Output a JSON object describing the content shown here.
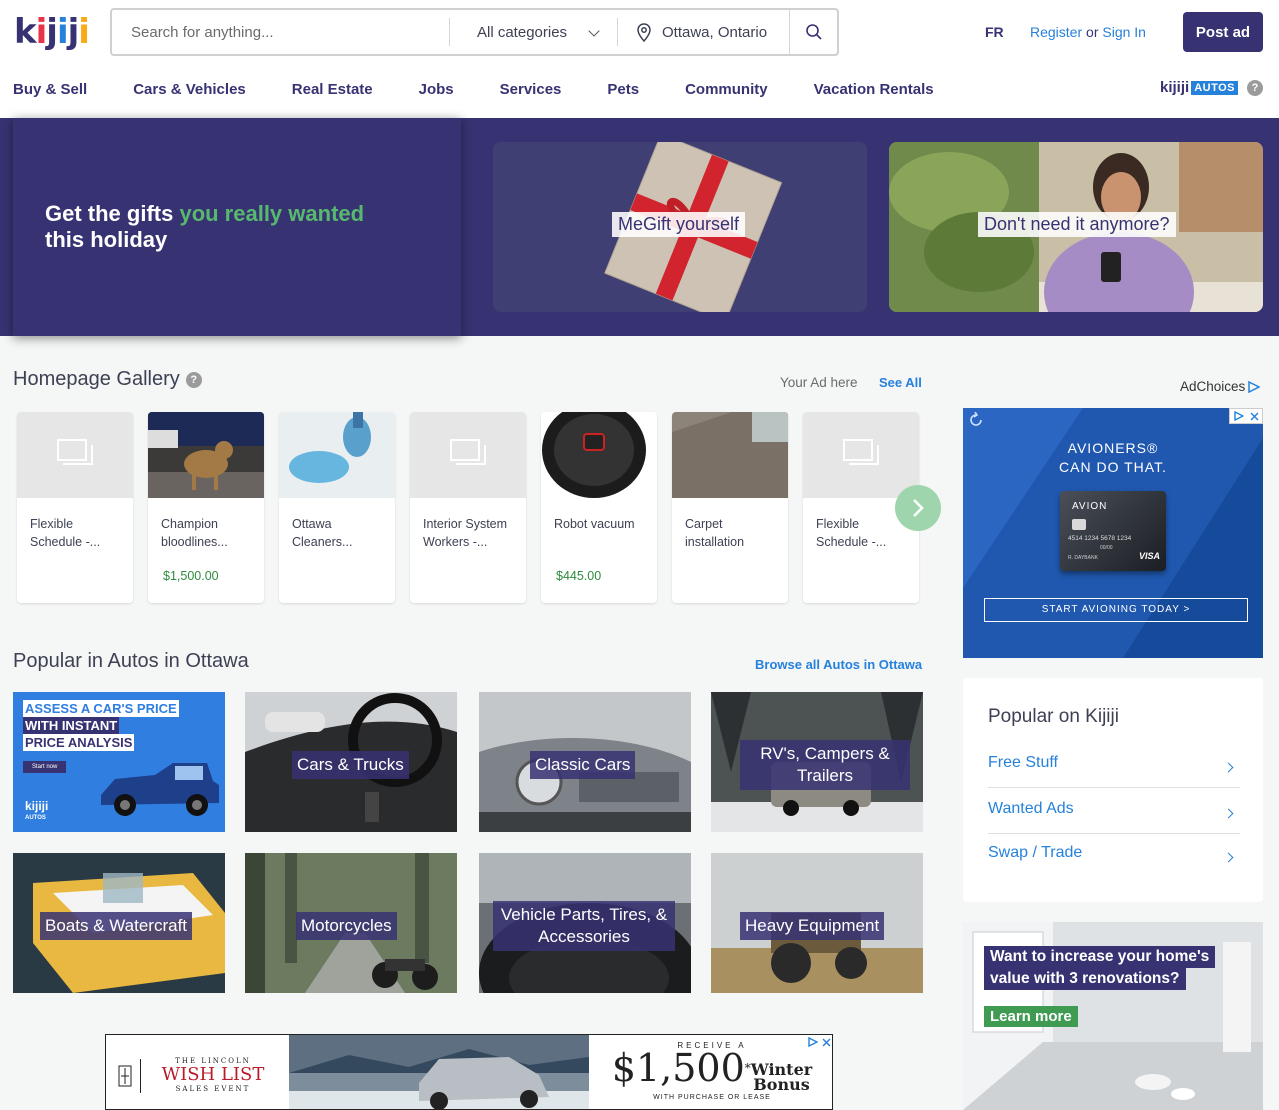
{
  "header": {
    "logo": "kijiji",
    "search_placeholder": "Search for anything...",
    "category": "All categories",
    "location": "Ottawa, Ontario",
    "lang": "FR",
    "register": "Register",
    "or": "or",
    "sign_in": "Sign In",
    "post_ad": "Post ad"
  },
  "nav": [
    "Buy & Sell",
    "Cars & Vehicles",
    "Real Estate",
    "Jobs",
    "Services",
    "Pets",
    "Community",
    "Vacation Rentals"
  ],
  "autos_logo": {
    "kijiji": "kijiji",
    "autos": "AUTOS"
  },
  "hero": {
    "text_a": "Get the gifts ",
    "text_hl": "you really wanted",
    "text_b": " this holiday",
    "tile1": "MeGift yourself",
    "tile2": "Don't need it anymore?"
  },
  "gallery": {
    "title": "Homepage Gallery",
    "your_ad": "Your Ad here",
    "see_all": "See All",
    "items": [
      {
        "title": "Flexible Schedule -...",
        "price": ""
      },
      {
        "title": "Champion bloodlines...",
        "price": "$1,500.00"
      },
      {
        "title": "Ottawa Cleaners...",
        "price": ""
      },
      {
        "title": "Interior System Workers -...",
        "price": ""
      },
      {
        "title": "Robot vacuum",
        "price": "$445.00"
      },
      {
        "title": "Carpet installation",
        "price": ""
      },
      {
        "title": "Flexible Schedule -...",
        "price": ""
      }
    ]
  },
  "autos": {
    "title": "Popular in Autos in Ottawa",
    "browse": "Browse all Autos in Ottawa",
    "promo": {
      "l1": "ASSESS A CAR'S PRICE",
      "l2": "WITH INSTANT",
      "l3": "PRICE ANALYSIS",
      "cta": "Start now",
      "logo": "kijiji",
      "logo2": "AUTOS"
    },
    "tiles": [
      "Cars & Trucks",
      "Classic Cars",
      "RV's, Campers & Trailers",
      "Boats & Watercraft",
      "Motorcycles",
      "Vehicle Parts, Tires, & Accessories",
      "Heavy Equipment"
    ]
  },
  "sidebar": {
    "adchoices": "AdChoices",
    "avion": {
      "l1": "AVIONERS®",
      "l2": "CAN DO THAT.",
      "card_brand": "AVION",
      "card_number": "4514 1234 5678 1234",
      "card_date": "00/00",
      "card_name": "R. DAYBANK",
      "visa": "VISA",
      "cta": "START AVIONING TODAY >"
    },
    "popular_title": "Popular on Kijiji",
    "popular": [
      "Free Stuff",
      "Wanted Ads",
      "Swap / Trade"
    ],
    "reno": {
      "l1": "Want to increase your home's",
      "l2": "value with 3 renovations?",
      "cta": "Learn more"
    }
  },
  "bottom_ad": {
    "brand_top": "THE LINCOLN",
    "brand": "WISH LIST",
    "brand_bottom": "SALES EVENT",
    "receive": "RECEIVE A",
    "amount": "$1,500",
    "star": "*",
    "winter": "Winter",
    "bonus": "Bonus",
    "sub": "WITH PURCHASE OR LEASE"
  },
  "colors": {
    "brand": "#373373",
    "link": "#2681db",
    "green": "#58b96e"
  }
}
